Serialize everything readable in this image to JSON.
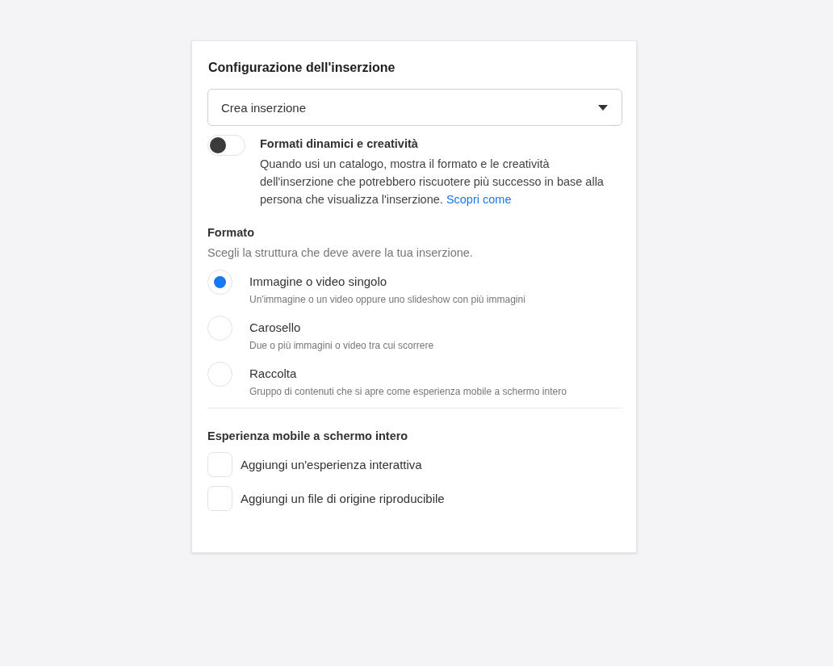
{
  "title": "Configurazione dell'inserzione",
  "dropdown": {
    "value": "Crea inserzione"
  },
  "dynamic": {
    "label": "Formati dinamici e creatività",
    "on": false,
    "description": "Quando usi un catalogo, mostra il formato e le creatività dell'inserzione che potrebbero riscuotere più successo in base alla persona che visualizza l'inserzione.",
    "link": "Scopri come"
  },
  "format": {
    "heading": "Formato",
    "subtitle": "Scegli la struttura che deve avere la tua inserzione.",
    "options": [
      {
        "label": "Immagine o video singolo",
        "description": "Un'immagine o un video oppure uno slideshow con più immagini",
        "selected": true
      },
      {
        "label": "Carosello",
        "description": "Due o più immagini o video tra cui scorrere",
        "selected": false
      },
      {
        "label": "Raccolta",
        "description": "Gruppo di contenuti che si apre come esperienza mobile a schermo intero",
        "selected": false
      }
    ]
  },
  "fullscreen": {
    "heading": "Esperienza mobile a schermo intero",
    "options": [
      {
        "label": "Aggiungi un'esperienza interattiva",
        "checked": false
      },
      {
        "label": "Aggiungi un file di origine riproducibile",
        "checked": false
      }
    ]
  }
}
